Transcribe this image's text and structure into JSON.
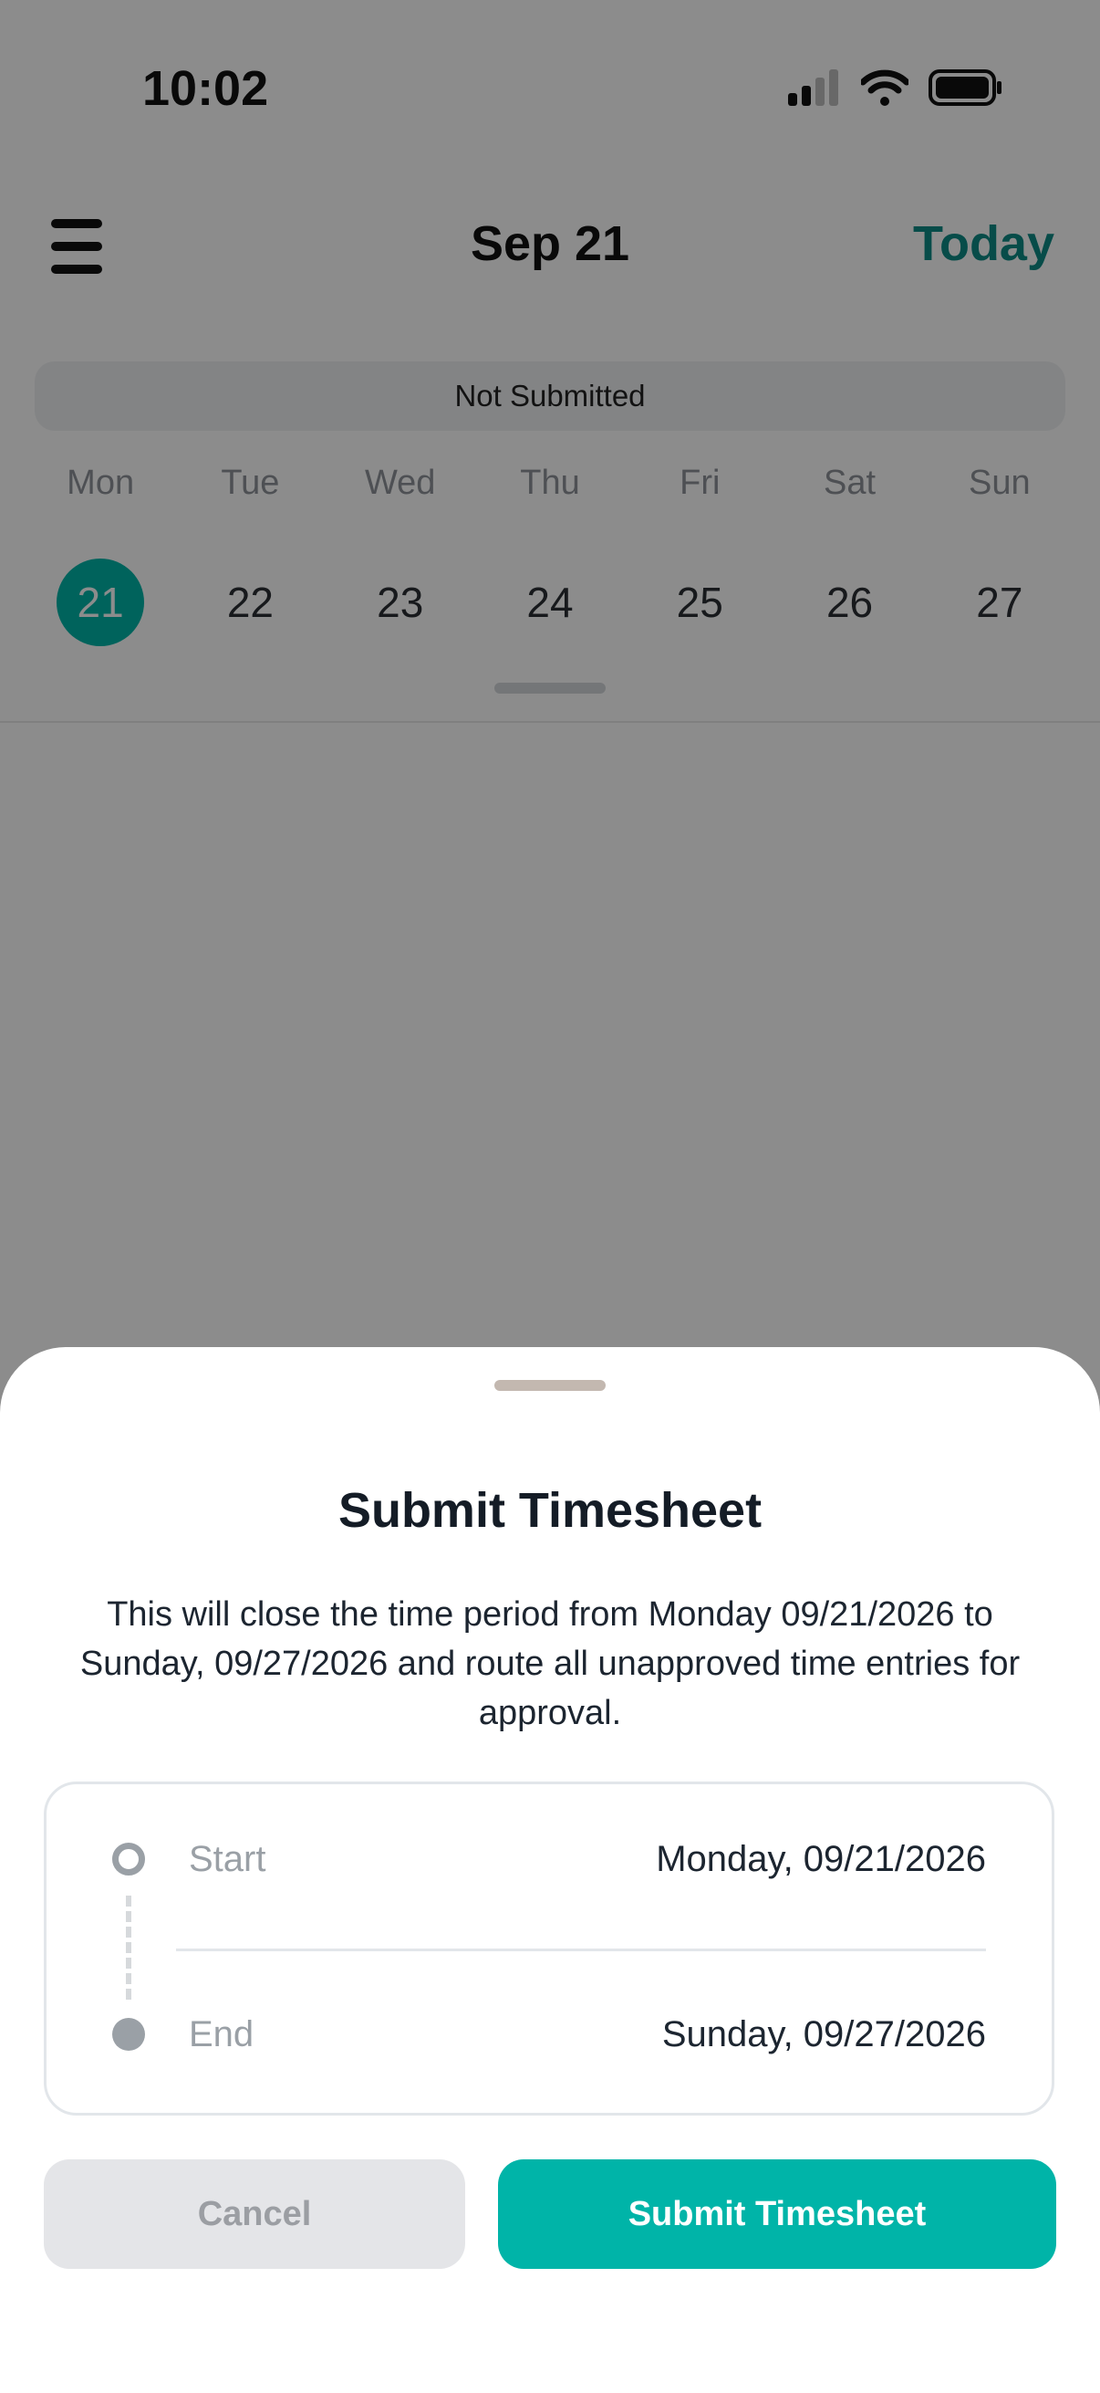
{
  "status_bar": {
    "time": "10:02"
  },
  "header": {
    "title": "Sep 21",
    "today_label": "Today"
  },
  "status_pill": "Not Submitted",
  "week": {
    "days": [
      "Mon",
      "Tue",
      "Wed",
      "Thu",
      "Fri",
      "Sat",
      "Sun"
    ],
    "dates": [
      "21",
      "22",
      "23",
      "24",
      "25",
      "26",
      "27"
    ],
    "selected_index": 0
  },
  "sheet": {
    "title": "Submit Timesheet",
    "description": "This will close the time period from Monday 09/21/2026 to Sunday, 09/27/2026 and route all unapproved time entries for approval.",
    "range": {
      "start_label": "Start",
      "start_value": "Monday, 09/21/2026",
      "end_label": "End",
      "end_value": "Sunday, 09/27/2026"
    },
    "cancel_label": "Cancel",
    "submit_label": "Submit Timesheet"
  },
  "colors": {
    "accent": "#00b4a8",
    "today_text": "#0e8b86"
  }
}
